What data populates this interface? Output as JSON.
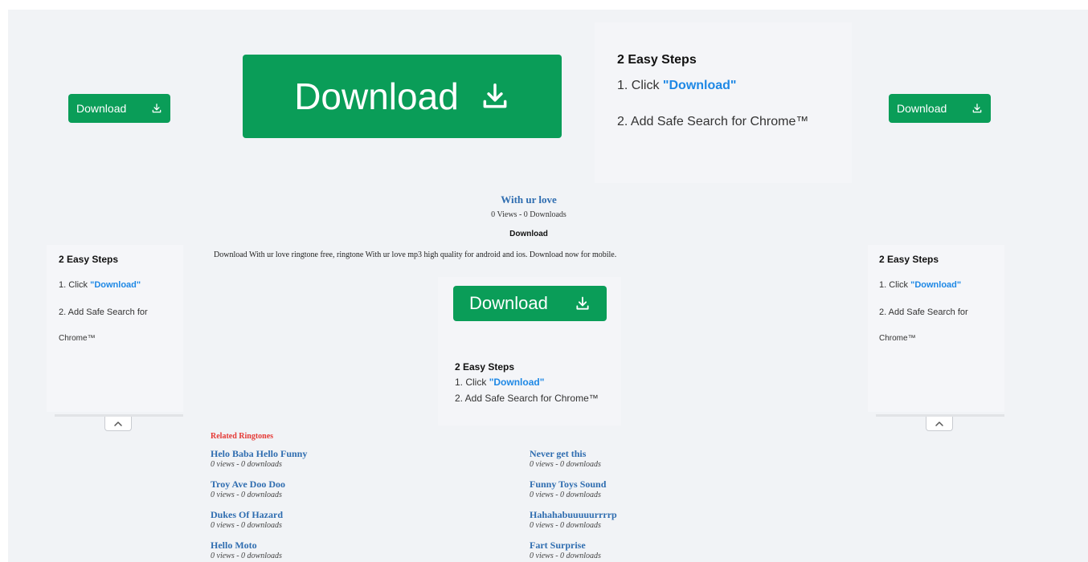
{
  "top_ad": {
    "button_label": "Download",
    "steps_title": "2 Easy Steps",
    "step1_prefix": "1. Click ",
    "step1_link": "\"Download\"",
    "step2": "2. Add Safe Search for Chrome™"
  },
  "left_ad": {
    "button_label": "Download",
    "steps_title": "2 Easy Steps",
    "step1_prefix": "1. Click ",
    "step1_link": "\"Download\"",
    "step2_line1": "2. Add Safe Search for",
    "step2_line2": "Chrome™"
  },
  "right_ad": {
    "button_label": "Download",
    "steps_title": "2 Easy Steps",
    "step1_prefix": "1. Click ",
    "step1_link": "\"Download\"",
    "step2_line1": "2. Add Safe Search for",
    "step2_line2": "Chrome™"
  },
  "ringtone": {
    "title": "With ur love",
    "stats": "0 Views - 0 Downloads",
    "download_heading": "Download",
    "description": "Download With ur love ringtone free, ringtone With ur love mp3 high quality for android and ios. Download now for mobile."
  },
  "center_ad": {
    "button_label": "Download",
    "steps_title": "2 Easy Steps",
    "step1_prefix": "1. Click ",
    "step1_link": "\"Download\"",
    "step2": "2. Add Safe Search for Chrome™"
  },
  "related": {
    "heading": "Related Ringtones",
    "left": [
      {
        "title": "Helo Baba Hello Funny",
        "meta": "0 views - 0 downloads"
      },
      {
        "title": "Troy Ave Doo Doo",
        "meta": "0 views - 0 downloads"
      },
      {
        "title": "Dukes Of Hazard",
        "meta": "0 views - 0 downloads"
      },
      {
        "title": "Hello Moto",
        "meta": "0 views - 0 downloads"
      }
    ],
    "right": [
      {
        "title": "Never get this",
        "meta": "0 views - 0 downloads"
      },
      {
        "title": "Funny Toys Sound",
        "meta": "0 views - 0 downloads"
      },
      {
        "title": "Hahahabuuuuurrrrp",
        "meta": "0 views - 0 downloads"
      },
      {
        "title": "Fart Surprise",
        "meta": "0 views - 0 downloads"
      }
    ]
  },
  "colors": {
    "button_green": "#0a9d58",
    "link_blue": "#1e88e5",
    "ringtone_blue": "#2f6db0",
    "related_red": "#e53935"
  },
  "icons": {
    "download": "download-icon",
    "collapse": "chevron-up-icon"
  }
}
